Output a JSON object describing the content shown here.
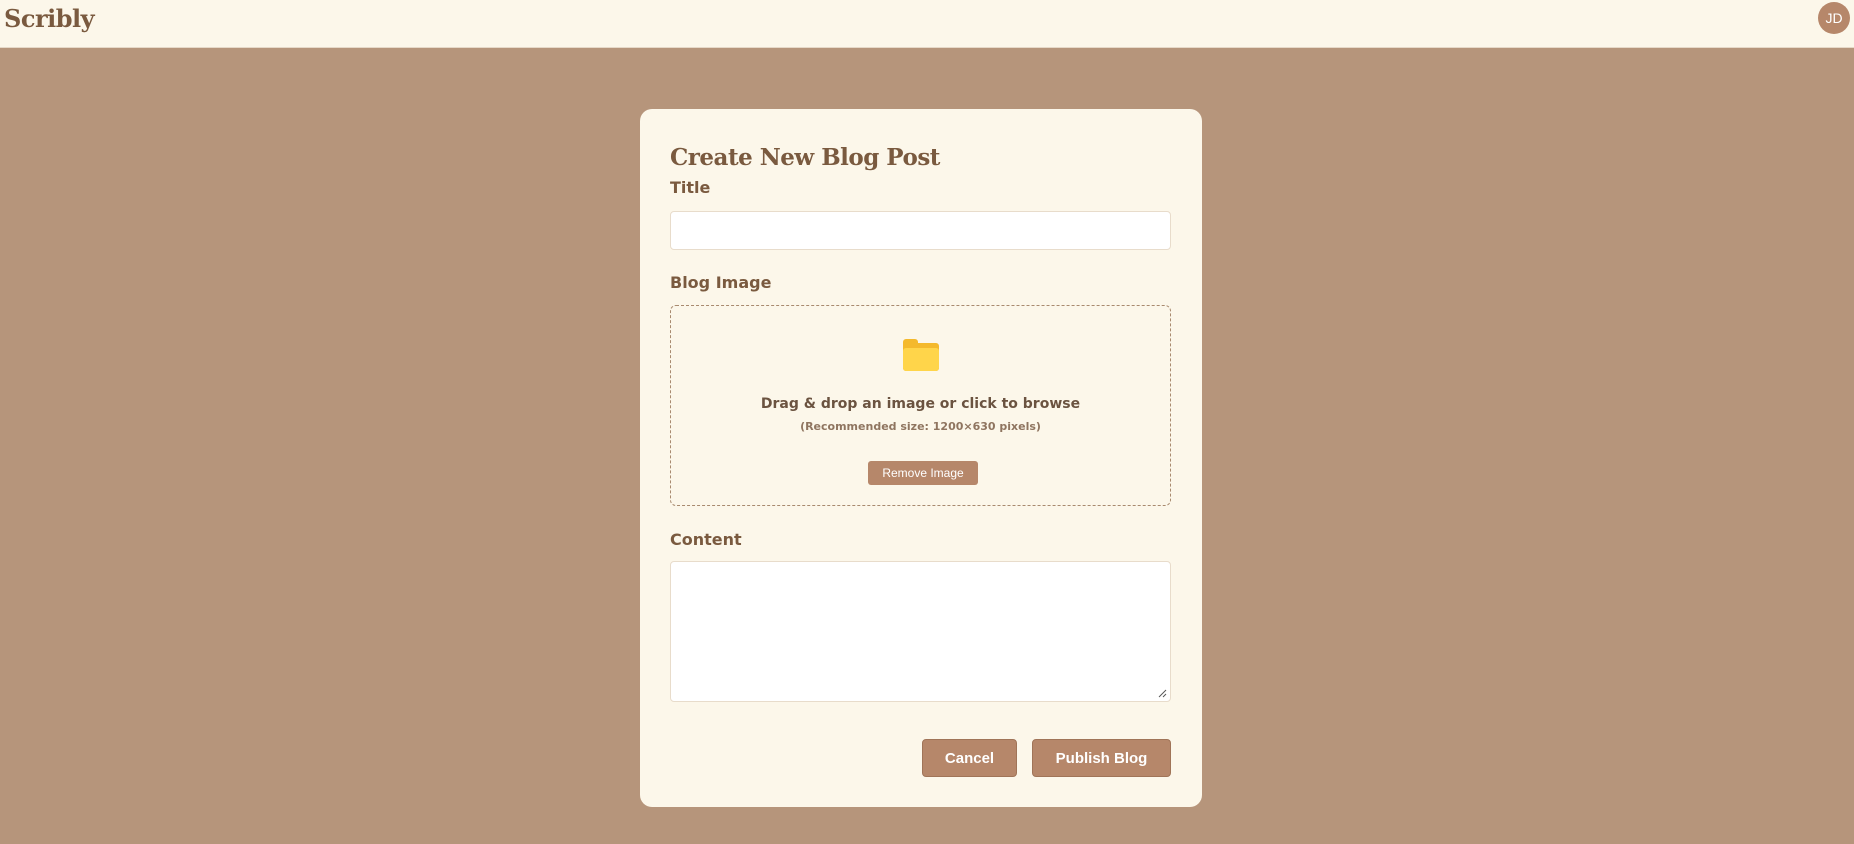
{
  "app": {
    "brand": "Scribly",
    "avatar_initials": "JD"
  },
  "form": {
    "heading": "Create New Blog Post",
    "title_label": "Title",
    "title_value": "",
    "image_label": "Blog Image",
    "dropzone": {
      "icon": "folder-icon",
      "text": "Drag & drop an image or click to browse",
      "hint": "(Recommended size: 1200×630 pixels)",
      "remove_label": "Remove Image"
    },
    "content_label": "Content",
    "content_value": "",
    "cancel_label": "Cancel",
    "publish_label": "Publish Blog"
  },
  "colors": {
    "background": "#b6957b",
    "card": "#fcf7ea",
    "accent": "#b6876a",
    "heading": "#7a5a3f",
    "folder": "#ffd54a"
  }
}
